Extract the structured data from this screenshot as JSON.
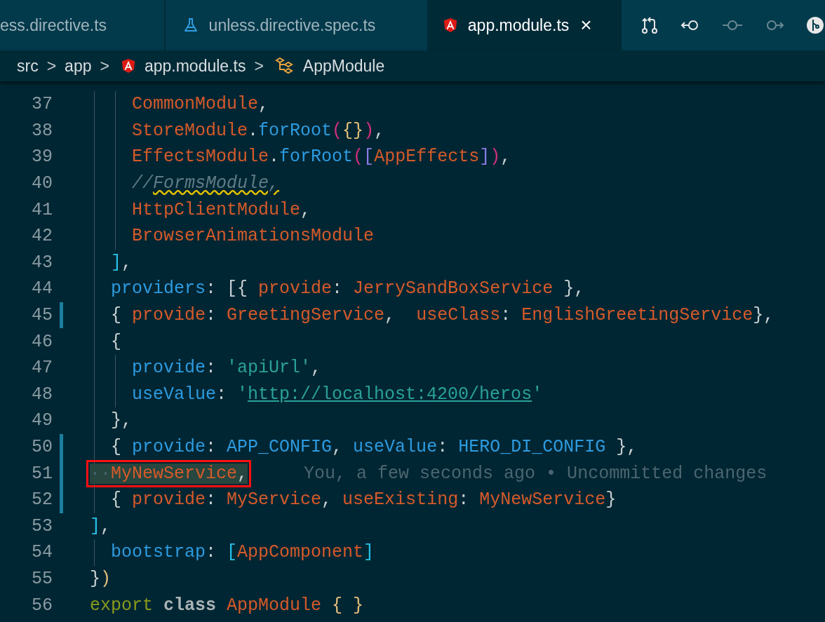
{
  "tabs": [
    {
      "label": "ess.directive.ts",
      "kind": "plain",
      "selected": false
    },
    {
      "label": "unless.directive.spec.ts",
      "kind": "test",
      "selected": false
    },
    {
      "label": "app.module.ts",
      "kind": "angular",
      "selected": true,
      "close": "×"
    }
  ],
  "toolbar": [
    {
      "kind": "compare"
    },
    {
      "kind": "prev"
    },
    {
      "kind": "commit",
      "disabled": true
    },
    {
      "kind": "next",
      "disabled": true
    },
    {
      "kind": "graph"
    }
  ],
  "breadcrumbs": [
    {
      "label": "src",
      "kind": "plain",
      "separator": ">"
    },
    {
      "label": "app",
      "kind": "plain",
      "separator": ">"
    },
    {
      "label": "app.module.ts",
      "kind": "angular",
      "separator": ">"
    },
    {
      "label": "AppModule",
      "kind": "module"
    }
  ],
  "lines": [
    {
      "number": "37",
      "modified": false,
      "tokens": [
        {
          "kind": "ident",
          "text": "    CommonModule"
        },
        {
          "kind": "punct",
          "text": ","
        }
      ]
    },
    {
      "number": "38",
      "modified": false,
      "tokens": [
        {
          "kind": "ident",
          "text": "    StoreModule"
        },
        {
          "kind": "punct",
          "text": "."
        },
        {
          "kind": "prop",
          "text": "forRoot"
        },
        {
          "kind": "paren",
          "text": "("
        },
        {
          "kind": "brace",
          "text": "{}"
        },
        {
          "kind": "paren",
          "text": ")"
        },
        {
          "kind": "punct",
          "text": ","
        }
      ]
    },
    {
      "number": "39",
      "modified": false,
      "tokens": [
        {
          "kind": "ident",
          "text": "    EffectsModule"
        },
        {
          "kind": "punct",
          "text": "."
        },
        {
          "kind": "prop",
          "text": "forRoot"
        },
        {
          "kind": "paren",
          "text": "("
        },
        {
          "kind": "square",
          "text": "["
        },
        {
          "kind": "ident",
          "text": "AppEffects"
        },
        {
          "kind": "square",
          "text": "]"
        },
        {
          "kind": "paren",
          "text": ")"
        },
        {
          "kind": "punct",
          "text": ","
        }
      ]
    },
    {
      "number": "40",
      "modified": false,
      "tokens": [
        {
          "kind": "comment",
          "text": "    //"
        },
        {
          "kind": "comment",
          "text": "FormsModule,",
          "warning": true
        }
      ]
    },
    {
      "number": "41",
      "modified": false,
      "tokens": [
        {
          "kind": "ident",
          "text": "    HttpClientModule"
        },
        {
          "kind": "punct",
          "text": ","
        }
      ]
    },
    {
      "number": "42",
      "modified": false,
      "tokens": [
        {
          "kind": "ident",
          "text": "    BrowserAnimationsModule"
        }
      ]
    },
    {
      "number": "43",
      "modified": false,
      "tokens": [
        {
          "kind": "bracket",
          "text": "  ]"
        },
        {
          "kind": "punct",
          "text": ","
        }
      ]
    },
    {
      "number": "44",
      "modified": false,
      "tokens": [
        {
          "kind": "prop",
          "text": "  providers"
        },
        {
          "kind": "punct",
          "text": ": [{ "
        },
        {
          "kind": "ident",
          "text": "provide"
        },
        {
          "kind": "punct",
          "text": ": "
        },
        {
          "kind": "ident",
          "text": "JerrySandBoxService"
        },
        {
          "kind": "punct",
          "text": " },"
        }
      ]
    },
    {
      "number": "45",
      "modified": true,
      "tokens": [
        {
          "kind": "punct",
          "text": "  { "
        },
        {
          "kind": "ident",
          "text": "provide"
        },
        {
          "kind": "punct",
          "text": ": "
        },
        {
          "kind": "ident",
          "text": "GreetingService"
        },
        {
          "kind": "punct",
          "text": ",  "
        },
        {
          "kind": "ident",
          "text": "useClass"
        },
        {
          "kind": "punct",
          "text": ": "
        },
        {
          "kind": "ident",
          "text": "EnglishGreetingService"
        },
        {
          "kind": "punct",
          "text": "},"
        }
      ]
    },
    {
      "number": "46",
      "modified": false,
      "tokens": [
        {
          "kind": "punct",
          "text": "  {"
        }
      ]
    },
    {
      "number": "47",
      "modified": false,
      "tokens": [
        {
          "kind": "prop",
          "text": "    provide"
        },
        {
          "kind": "punct",
          "text": ": "
        },
        {
          "kind": "string",
          "text": "'apiUrl'"
        },
        {
          "kind": "punct",
          "text": ","
        }
      ]
    },
    {
      "number": "48",
      "modified": false,
      "tokens": [
        {
          "kind": "prop",
          "text": "    useValue"
        },
        {
          "kind": "punct",
          "text": ": "
        },
        {
          "kind": "string",
          "text": "'"
        },
        {
          "kind": "link",
          "text": "http://localhost:4200/heros"
        },
        {
          "kind": "string",
          "text": "'"
        }
      ]
    },
    {
      "number": "49",
      "modified": false,
      "tokens": [
        {
          "kind": "punct",
          "text": "  },"
        }
      ]
    },
    {
      "number": "50",
      "modified": true,
      "tokens": [
        {
          "kind": "punct",
          "text": "  { "
        },
        {
          "kind": "prop",
          "text": "provide"
        },
        {
          "kind": "punct",
          "text": ": "
        },
        {
          "kind": "prop",
          "text": "APP_CONFIG"
        },
        {
          "kind": "punct",
          "text": ", "
        },
        {
          "kind": "prop",
          "text": "useValue"
        },
        {
          "kind": "punct",
          "text": ": "
        },
        {
          "kind": "prop",
          "text": "HERO_DI_CONFIG"
        },
        {
          "kind": "punct",
          "text": " },"
        }
      ]
    },
    {
      "number": "51",
      "modified": true,
      "boxed": true,
      "blame": "You, a few seconds ago • Uncommitted changes",
      "tokens": [
        {
          "kind": "whitespace",
          "text": "··"
        },
        {
          "kind": "ident",
          "text": "MyNewService"
        },
        {
          "kind": "punct",
          "text": ","
        }
      ]
    },
    {
      "number": "52",
      "modified": true,
      "tokens": [
        {
          "kind": "punct",
          "text": "  { "
        },
        {
          "kind": "ident",
          "text": "provide"
        },
        {
          "kind": "punct",
          "text": ": "
        },
        {
          "kind": "ident",
          "text": "MyService"
        },
        {
          "kind": "punct",
          "text": ", "
        },
        {
          "kind": "ident",
          "text": "useExisting"
        },
        {
          "kind": "punct",
          "text": ": "
        },
        {
          "kind": "ident",
          "text": "MyNewService"
        },
        {
          "kind": "punct",
          "text": "}"
        }
      ]
    },
    {
      "number": "53",
      "modified": false,
      "tokens": [
        {
          "kind": "bracket",
          "text": "]"
        },
        {
          "kind": "punct",
          "text": ","
        }
      ]
    },
    {
      "number": "54",
      "modified": false,
      "tokens": [
        {
          "kind": "prop",
          "text": "  bootstrap"
        },
        {
          "kind": "punct",
          "text": ": "
        },
        {
          "kind": "bracket",
          "text": "["
        },
        {
          "kind": "ident",
          "text": "AppComponent"
        },
        {
          "kind": "bracket",
          "text": "]"
        }
      ]
    },
    {
      "number": "55",
      "modified": false,
      "tokens": [
        {
          "kind": "punct",
          "text": "}"
        },
        {
          "kind": "brace",
          "text": ")"
        }
      ]
    },
    {
      "number": "56",
      "modified": false,
      "tokens": [
        {
          "kind": "keyword",
          "text": "export"
        },
        {
          "kind": "keyword2",
          "text": " class"
        },
        {
          "kind": "ident",
          "text": " AppModule"
        },
        {
          "kind": "brace",
          "text": " { }"
        }
      ]
    }
  ]
}
